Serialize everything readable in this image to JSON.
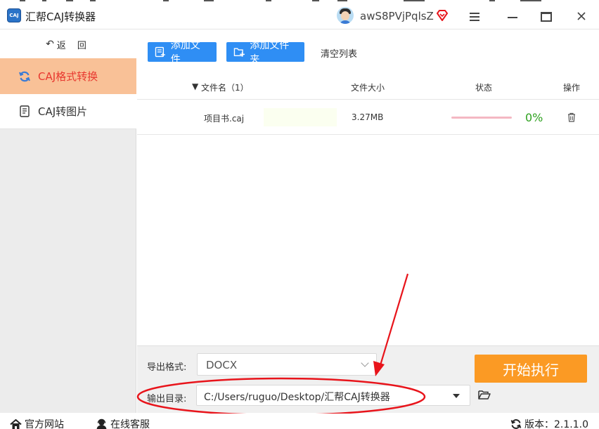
{
  "app": {
    "title": "汇帮CAJ转换器",
    "logo_text": "CAJ",
    "username": "awS8PVjPqlsZ"
  },
  "sidebar": {
    "back_label": "返 回",
    "items": [
      {
        "label": "CAJ格式转换",
        "active": true
      },
      {
        "label": "CAJ转图片",
        "active": false
      }
    ]
  },
  "toolbar": {
    "add_file": "添加文件",
    "add_folder": "添加文件夹",
    "clear_list": "清空列表"
  },
  "table": {
    "headers": {
      "filename": "文件名（1）",
      "filesize": "文件大小",
      "status": "状态",
      "action": "操作"
    },
    "rows": [
      {
        "name": "项目书.caj",
        "size": "3.27MB",
        "progress_percent": "0%",
        "progress": 0
      }
    ]
  },
  "settings": {
    "export_format_label": "导出格式:",
    "export_format_value": "DOCX",
    "output_dir_label": "输出目录:",
    "output_dir_value": "C:/Users/ruguo/Desktop/汇帮CAJ转换器",
    "start_label": "开始执行"
  },
  "statusbar": {
    "website": "官方网站",
    "support": "在线客服",
    "version": "版本：2.1.1.0"
  },
  "colors": {
    "accent_blue": "#2f8ef4",
    "active_nav_bg": "#f9c197",
    "active_nav_text": "#e8382f",
    "start_button": "#fb9a24",
    "annotation_red": "#e8141b",
    "progress_green": "#2ea11f"
  }
}
